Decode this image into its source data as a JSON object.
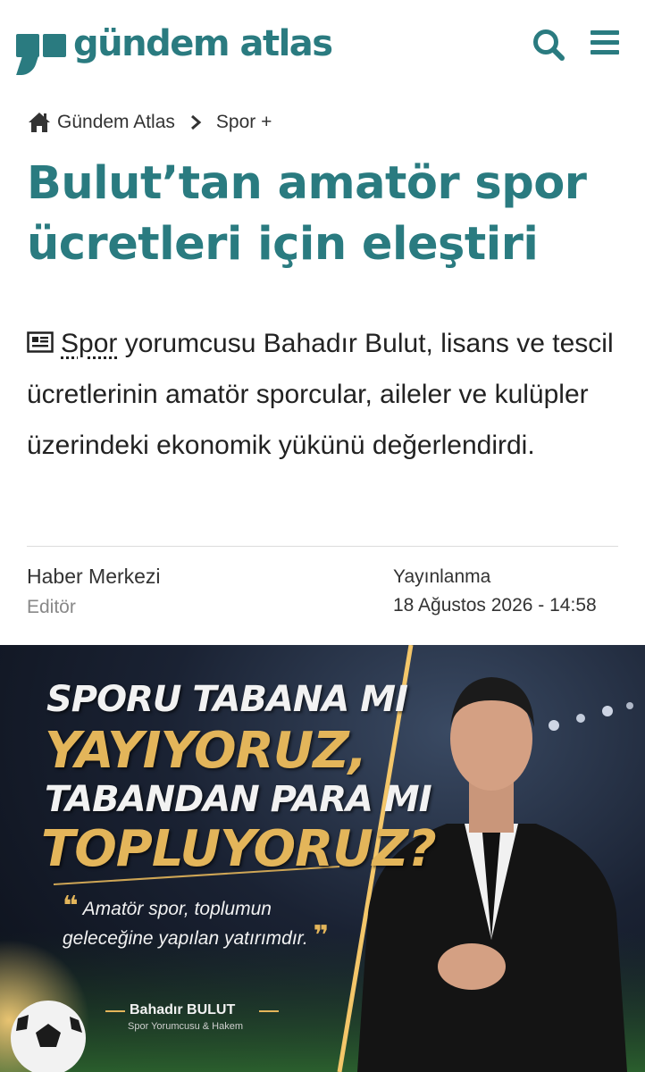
{
  "site": {
    "logo_text": "gündem atlas",
    "brand_color": "#2a7b80",
    "icons": [
      "search-icon",
      "menu-icon"
    ]
  },
  "breadcrumb": {
    "home_icon": "home-icon",
    "home_label": "Gündem Atlas",
    "section_label": "Spor +"
  },
  "article": {
    "title": "Bulut’tan amatör spor ücretleri için eleştiri",
    "summary_tag": "Spor",
    "summary_text": " yorumcusu Bahadır Bulut, lisans ve tescil ücretlerinin amatör sporcular, aileler ve kulüpler üzerindeki ekonomik yükünü değerlendirdi.",
    "author": "Haber Merkezi",
    "author_role": "Editör",
    "published_label": "Yayınlanma",
    "published_date": "18 Ağustos 2026 - 14:58"
  },
  "hero": {
    "headline_1": "SPORU TABANA MI",
    "headline_2": "YAYIYORUZ,",
    "headline_3": "TABANDAN PARA MI",
    "headline_4": "TOPLUYORUZ?",
    "quote_open": "❝",
    "quote_text": "Amatör spor, toplumun geleceğine yapılan yatırımdır.",
    "quote_close": "❞",
    "signature_name": "Bahadır BULUT",
    "signature_role": "Spor Yorumcusu & Hakem",
    "accent_color": "#e3b55a"
  }
}
